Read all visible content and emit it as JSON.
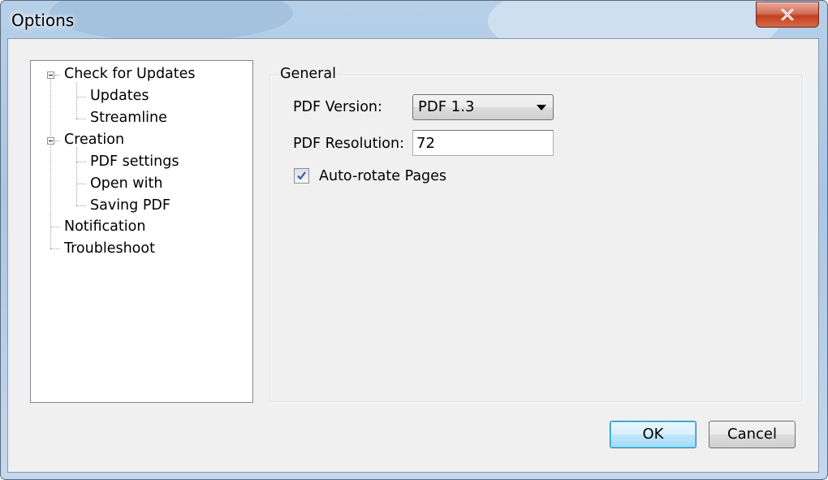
{
  "window": {
    "title": "Options",
    "close_icon": "close-icon"
  },
  "tree": {
    "items": [
      {
        "label": "Check for Updates",
        "level": 0,
        "expanded": true
      },
      {
        "label": "Updates",
        "level": 1
      },
      {
        "label": "Streamline",
        "level": 1
      },
      {
        "label": "Creation",
        "level": 0,
        "expanded": true
      },
      {
        "label": "PDF settings",
        "level": 1
      },
      {
        "label": "Open with",
        "level": 1
      },
      {
        "label": "Saving PDF",
        "level": 1
      },
      {
        "label": "Notification",
        "level": 0
      },
      {
        "label": "Troubleshoot",
        "level": 0
      }
    ]
  },
  "general": {
    "group_label": "General",
    "pdf_version_label": "PDF Version:",
    "pdf_version_value": "PDF 1.3",
    "pdf_resolution_label": "PDF Resolution:",
    "pdf_resolution_value": "72",
    "autorotate_label": "Auto-rotate Pages",
    "autorotate_checked": true
  },
  "buttons": {
    "ok": "OK",
    "cancel": "Cancel"
  },
  "colors": {
    "title_glass": "#b7d0e8",
    "close_button": "#c2401f",
    "default_button_border": "#3c7fb1"
  }
}
